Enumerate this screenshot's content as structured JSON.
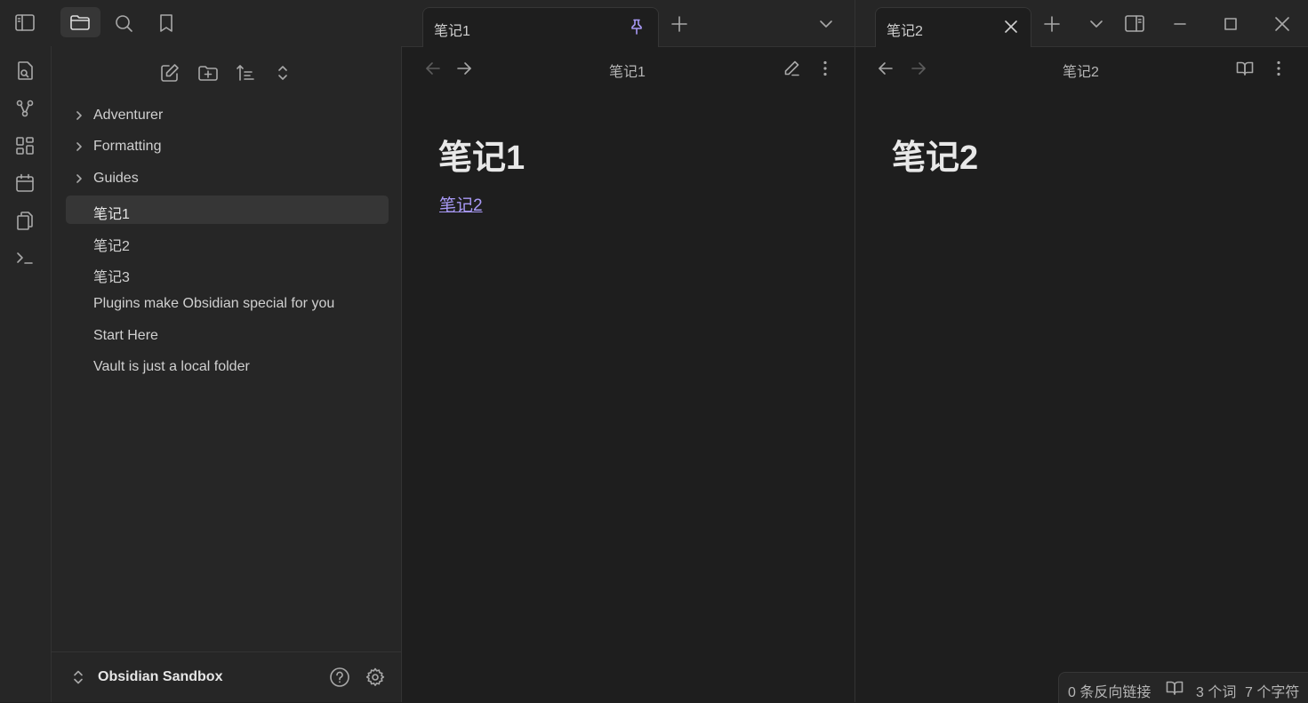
{
  "ribbon": {
    "icons": [
      "sidebar-toggle-icon",
      "folder-icon",
      "search-icon",
      "bookmark-icon",
      "quick-switcher-icon",
      "graph-icon",
      "canvas-icon",
      "calendar-icon",
      "templates-icon",
      "terminal-icon"
    ]
  },
  "sidebar": {
    "toolbar_icons": [
      "new-note-icon",
      "new-folder-icon",
      "sort-icon",
      "collapse-all-icon"
    ],
    "tree": [
      {
        "label": "Adventurer",
        "folder": true
      },
      {
        "label": "Formatting",
        "folder": true
      },
      {
        "label": "Guides",
        "folder": true
      },
      {
        "label": "笔记1",
        "folder": false,
        "active": true
      },
      {
        "label": "笔记2",
        "folder": false
      },
      {
        "label": "笔记3",
        "folder": false
      },
      {
        "label": "Plugins make Obsidian special for you",
        "folder": false
      },
      {
        "label": "Start Here",
        "folder": false
      },
      {
        "label": "Vault is just a local folder",
        "folder": false
      }
    ],
    "vault_name": "Obsidian Sandbox"
  },
  "pane1": {
    "tab_title": "笔记1",
    "view_title": "笔记1",
    "heading": "笔记1",
    "link_text": "笔记2"
  },
  "pane2": {
    "tab_title": "笔记2",
    "view_title": "笔记2",
    "heading": "笔记2"
  },
  "statusbar": {
    "backlinks": "0 条反向链接",
    "words": "3 个词",
    "chars": "7 个字符"
  },
  "colors": {
    "accent": "#a899f5",
    "background": "#1e1e1e",
    "sidebar": "#262626"
  }
}
